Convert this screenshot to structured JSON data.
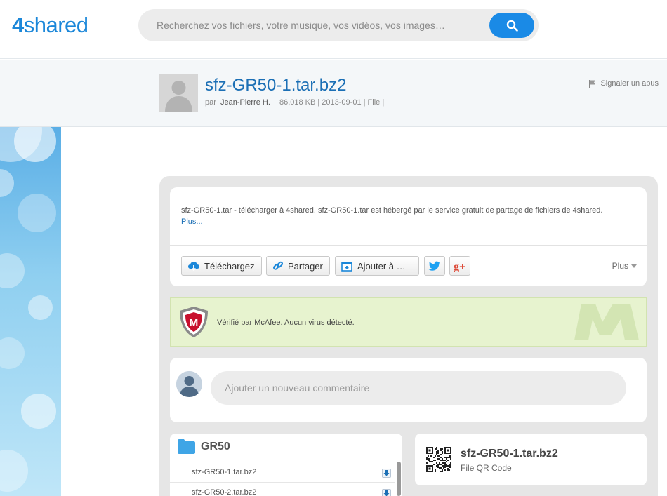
{
  "header": {
    "logo_number": "4",
    "logo_text": "shared",
    "search_placeholder": "Recherchez vos fichiers, votre musique, vos vidéos, vos images…"
  },
  "file": {
    "title": "sfz-GR50-1.tar.bz2",
    "by_label": "par",
    "owner": "Jean-Pierre H.",
    "meta": "86,018 KB | 2013-09-01 | File |",
    "report_label": "Signaler un abus"
  },
  "description": {
    "text": "sfz-GR50-1.tar - télécharger à 4shared. sfz-GR50-1.tar est hébergé par le service gratuit de partage de fichiers de 4shared.",
    "more_label": "Plus..."
  },
  "actions": {
    "download_label": "Téléchargez",
    "share_label": "Partager",
    "add_label": "Ajouter à …",
    "more_label": "Plus"
  },
  "virus": {
    "text": "Vérifié par McAfee. Aucun virus détecté."
  },
  "comment": {
    "placeholder": "Ajouter un nouveau commentaire"
  },
  "folder": {
    "name": "GR50",
    "files": [
      {
        "name": "sfz-GR50-1.tar.bz2"
      },
      {
        "name": "sfz-GR50-2.tar.bz2"
      }
    ]
  },
  "qr": {
    "title": "sfz-GR50-1.tar.bz2",
    "subtitle": "File QR Code"
  },
  "colors": {
    "brand_blue": "#1b87d9",
    "search_button": "#1a8ae6",
    "virus_bg": "#e7f3cf",
    "link_blue": "#1b6fb5"
  }
}
